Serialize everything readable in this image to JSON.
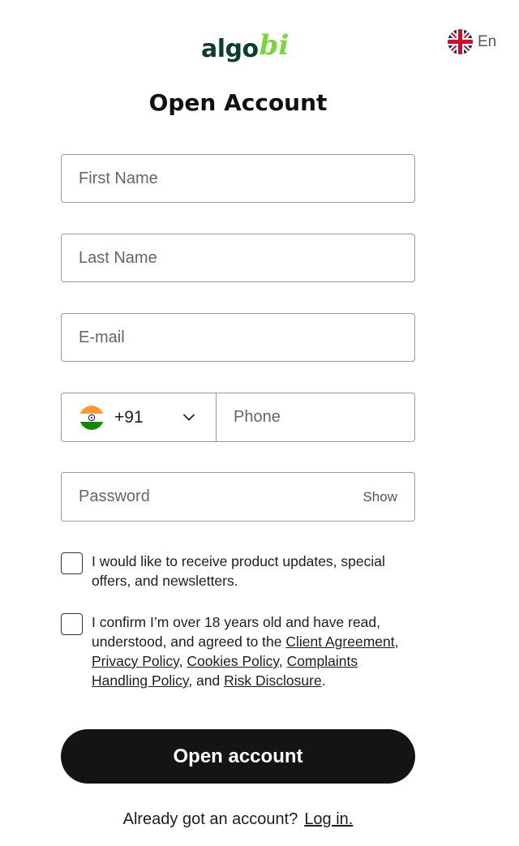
{
  "header": {
    "logo_main": "algo",
    "logo_accent": "bi",
    "language_code": "En",
    "language_flag_icon": "uk-flag-icon"
  },
  "form": {
    "title": "Open Account",
    "first_name_placeholder": "First Name",
    "last_name_placeholder": "Last Name",
    "email_placeholder": "E-mail",
    "country_flag_icon": "india-flag-icon",
    "dial_code": "+91",
    "phone_placeholder": "Phone",
    "password_placeholder": "Password",
    "show_label": "Show",
    "marketing_consent": "I would like to receive product updates, special offers, and newsletters.",
    "terms": {
      "intro": "I confirm I’m over 18 years old and have read, understood, and agreed to the ",
      "client_agreement": "Client Agreement",
      "sep1": ", ",
      "privacy_policy": "Privacy Policy",
      "sep2": ", ",
      "cookies_policy": "Cookies Policy",
      "sep3": ", ",
      "complaints_policy": "Complaints Handling Policy",
      "sep4": ", and ",
      "risk_disclosure": "Risk Disclosure",
      "end": "."
    },
    "submit_label": "Open account",
    "login_prompt": "Already got an account?",
    "login_link": "Log in."
  },
  "colors": {
    "brand_dark": "#0f3d2a",
    "brand_accent": "#7cd63a",
    "button_bg": "#141416"
  }
}
